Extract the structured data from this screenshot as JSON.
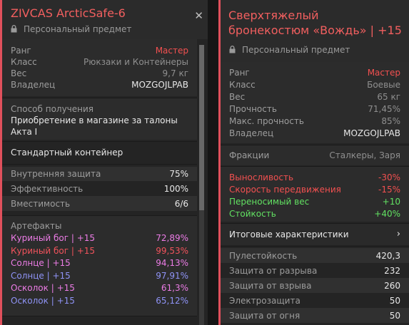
{
  "left": {
    "title": "ZIVCAS ArcticSafe-6",
    "close_icon": "✕",
    "personal": "Персональный предмет",
    "info": [
      {
        "label": "Ранг",
        "value": "Мастер"
      },
      {
        "label": "Класс",
        "value": "Рюкзаки и Контейнеры"
      },
      {
        "label": "Вес",
        "value": "9,7 кг"
      },
      {
        "label": "Владелец",
        "value": "MOZGOJLPAB"
      }
    ],
    "obtain_label": "Способ получения",
    "obtain_value": "Приобретение в магазине за талоны Акта I",
    "container_type": "Стандартный контейнер",
    "stats": [
      {
        "label": "Внутренняя защита",
        "value": "75%"
      },
      {
        "label": "Эффективность",
        "value": "100%"
      },
      {
        "label": "Вместимость",
        "value": "6/6"
      }
    ],
    "artifacts_label": "Артефакты",
    "artifacts": [
      {
        "name": "Куриный бог | +15",
        "value": "72,89%",
        "color": "#ec7ce6"
      },
      {
        "name": "Куриный бог | +15",
        "value": "99,53%",
        "color": "#f2535c"
      },
      {
        "name": "Солнце | +15",
        "value": "94,13%",
        "color": "#ec7ce6"
      },
      {
        "name": "Солнце | +15",
        "value": "97,91%",
        "color": "#8f93f6"
      },
      {
        "name": "Осколок | +15",
        "value": "61,3%",
        "color": "#ec7ce6"
      },
      {
        "name": "Осколок | +15",
        "value": "65,12%",
        "color": "#8f93f6"
      }
    ],
    "scrollbar_position": 0.0
  },
  "right": {
    "title": "Сверхтяжелый бронекостюм «Вождь» | +15",
    "personal": "Персональный предмет",
    "info": [
      {
        "label": "Ранг",
        "value": "Мастер"
      },
      {
        "label": "Класс",
        "value": "Боевые"
      },
      {
        "label": "Вес",
        "value": "65 кг"
      },
      {
        "label": "Прочность",
        "value": "71,45%"
      },
      {
        "label": "Макс. прочность",
        "value": "85%"
      },
      {
        "label": "Владелец",
        "value": "MOZGOJLPAB"
      }
    ],
    "factions_label": "Фракции",
    "factions_value": "Сталкеры, Заря",
    "modifiers": [
      {
        "label": "Выносливость",
        "value": "-30%",
        "color": "#f25050"
      },
      {
        "label": "Скорость передвижения",
        "value": "-15%",
        "color": "#f25050"
      },
      {
        "label": "Переносимый вес",
        "value": "+10",
        "color": "#62e162"
      },
      {
        "label": "Стойкость",
        "value": "+40%",
        "color": "#62e162"
      }
    ],
    "summary_label": "Итоговые характеристики",
    "summary_chevron": "›",
    "protection": [
      {
        "label": "Пулестойкость",
        "value": "420,3"
      },
      {
        "label": "Защита от разрыва",
        "value": "232"
      },
      {
        "label": "Защита от взрыва",
        "value": "260"
      },
      {
        "label": "Электрозащита",
        "value": "50"
      },
      {
        "label": "Защита от огня",
        "value": "50"
      }
    ]
  },
  "colors": {
    "accent": "#e0505c",
    "title": "#f25f5f",
    "rank": "#f25050",
    "positive": "#62e162"
  }
}
